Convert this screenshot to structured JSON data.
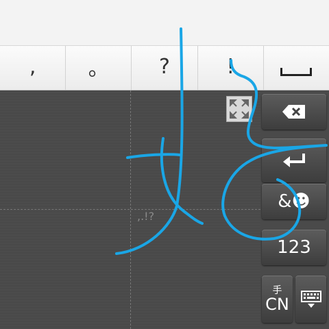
{
  "punctuation": [
    ",",
    "。",
    "?",
    "!"
  ],
  "handwriting_hint": ",.!?",
  "keys": {
    "symbols": "&☻",
    "numbers": "123",
    "cn_small": "手",
    "cn_big": "CN"
  },
  "icons": {
    "space": "space-bar-icon",
    "expand": "expand-icon",
    "delete": "backspace-icon",
    "enter": "enter-icon",
    "keyboard": "keyboard-icon"
  },
  "colors": {
    "stroke": "#1aa6e6",
    "pad": "#4a4a4a"
  }
}
